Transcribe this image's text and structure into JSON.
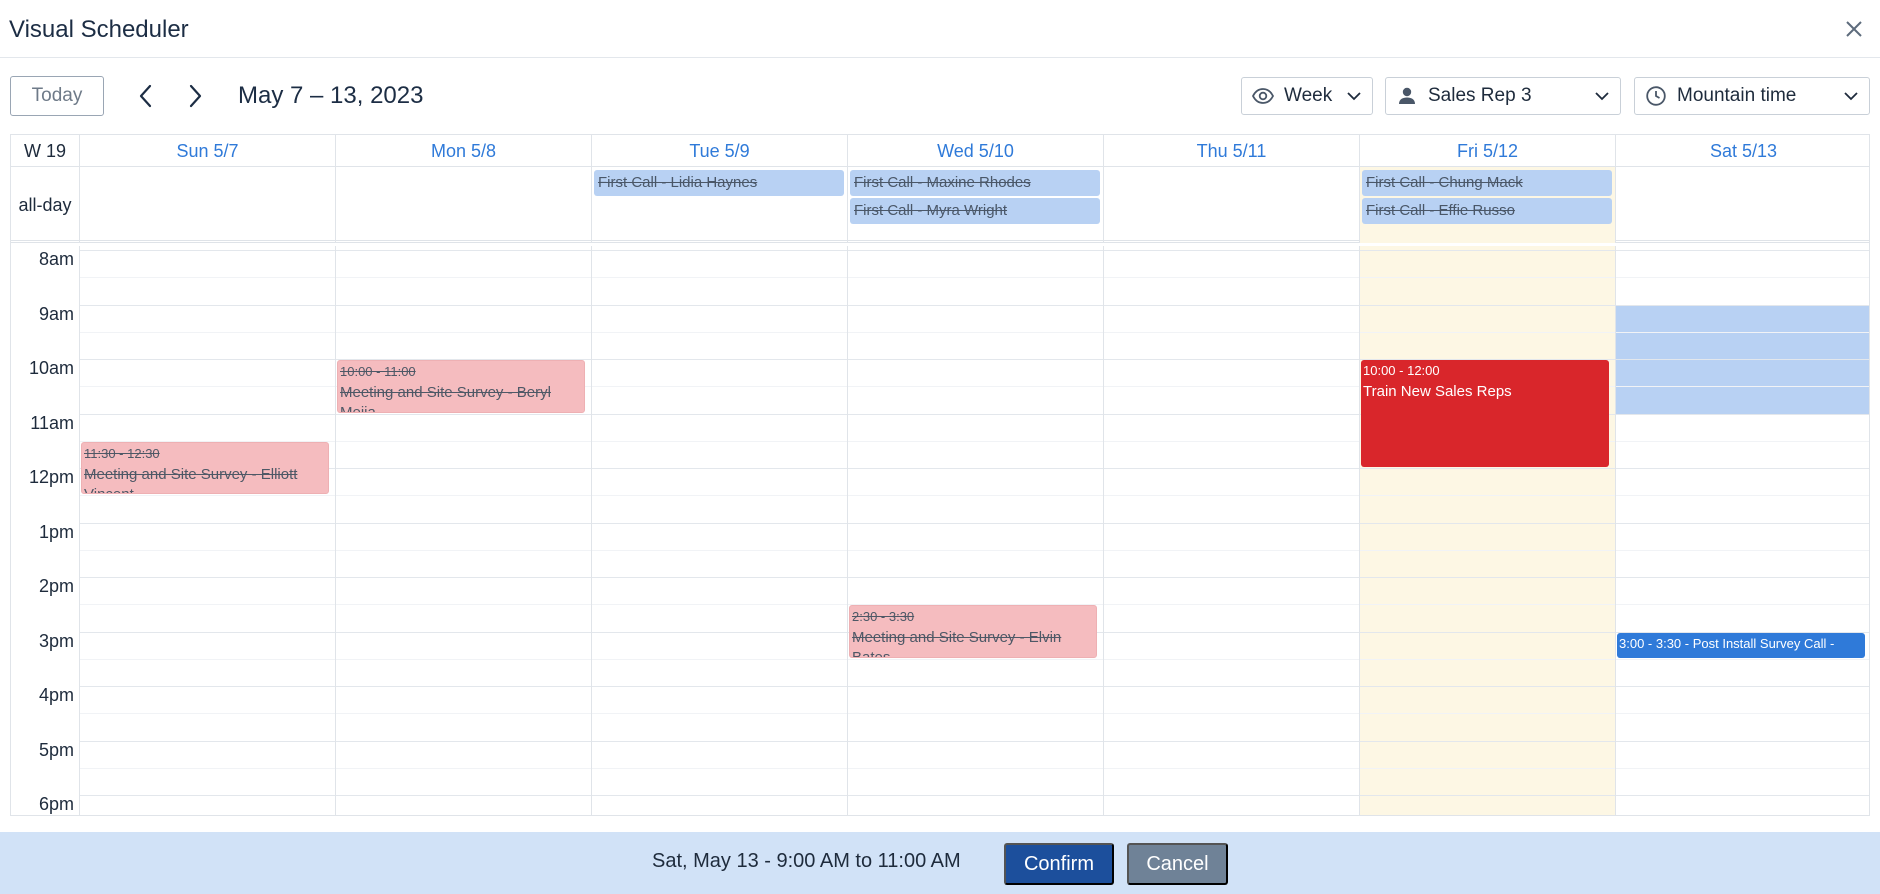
{
  "window": {
    "title": "Visual Scheduler",
    "close_icon": "close-icon"
  },
  "toolbar": {
    "today_label": "Today",
    "prev_icon": "chevron-left-icon",
    "next_icon": "chevron-right-icon",
    "range_label": "May 7 – 13, 2023",
    "view_select": {
      "value": "Week",
      "icon": "eye-icon"
    },
    "resource_select": {
      "value": "Sales Rep 3",
      "icon": "person-icon"
    },
    "timezone_select": {
      "value": "Mountain time",
      "icon": "clock-icon"
    }
  },
  "calendar": {
    "week_label": "W 19",
    "allday_label": "all-day",
    "days": [
      {
        "label": "Sun 5/7"
      },
      {
        "label": "Mon 5/8"
      },
      {
        "label": "Tue 5/9"
      },
      {
        "label": "Wed 5/10"
      },
      {
        "label": "Thu 5/11"
      },
      {
        "label": "Fri 5/12",
        "today": true
      },
      {
        "label": "Sat 5/13"
      }
    ],
    "hours": [
      "8am",
      "9am",
      "10am",
      "11am",
      "12pm",
      "1pm",
      "2pm",
      "3pm",
      "4pm",
      "5pm",
      "6pm"
    ],
    "allday_events": [
      {
        "day": 2,
        "row": 0,
        "title": "First Call - Lidia Haynes",
        "cancelled": true
      },
      {
        "day": 3,
        "row": 0,
        "title": "First Call - Maxine Rhodes",
        "cancelled": true
      },
      {
        "day": 3,
        "row": 1,
        "title": "First Call - Myra Wright",
        "cancelled": true
      },
      {
        "day": 5,
        "row": 0,
        "title": "First Call - Chung Mack",
        "cancelled": true
      },
      {
        "day": 5,
        "row": 1,
        "title": "First Call - Effie Russo",
        "cancelled": true
      }
    ],
    "events": [
      {
        "day": 0,
        "start": 11.5,
        "end": 12.5,
        "time": "11:30 - 12:30",
        "title": "Meeting and Site Survey - Elliott Vincent",
        "style": "pink"
      },
      {
        "day": 1,
        "start": 10,
        "end": 11,
        "time": "10:00 - 11:00",
        "title": "Meeting and Site Survey - Beryl Mejia",
        "style": "pink"
      },
      {
        "day": 3,
        "start": 14.5,
        "end": 15.5,
        "time": "2:30 - 3:30",
        "title": "Meeting and Site Survey - Elvin Bates",
        "style": "pink"
      },
      {
        "day": 5,
        "start": 10,
        "end": 12,
        "time": "10:00 - 12:00",
        "title": "Train New Sales Reps",
        "style": "red"
      },
      {
        "day": 6,
        "start": 15,
        "end": 15.5,
        "time": "3:00 - 3:30 - Post Install Survey Call -",
        "title": "",
        "style": "blue"
      }
    ],
    "selection": {
      "day": 6,
      "start": 9,
      "end": 11
    }
  },
  "footer": {
    "selection_text": "Sat, May 13 - 9:00 AM to 11:00 AM",
    "confirm_label": "Confirm",
    "cancel_label": "Cancel"
  },
  "colors": {
    "accent": "#2f7ad9",
    "today_bg": "#fdf7e4",
    "cancelled_event": "#f5bcbf",
    "primary_event": "#d9262b",
    "allday_event": "#b8d1f3",
    "footer_bg": "#d1e2f7",
    "confirm_bg": "#1c4f9c",
    "cancel_bg": "#6f8297"
  }
}
